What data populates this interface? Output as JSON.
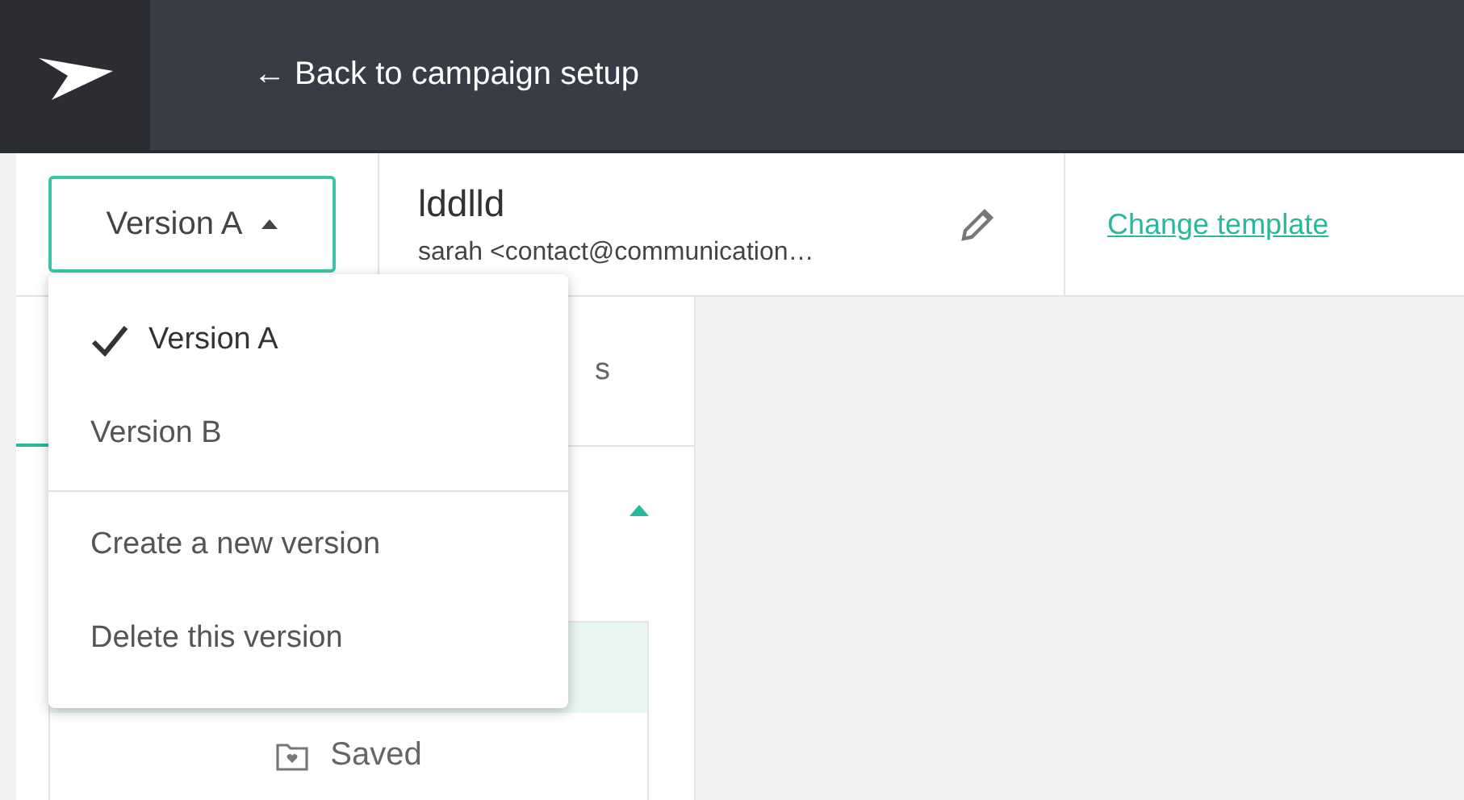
{
  "top_bar": {
    "back_link": "← Back to campaign setup"
  },
  "header": {
    "version_button": "Version A",
    "title": "lddlld",
    "sender": "sarah <contact@communication…",
    "change_template": "Change template"
  },
  "version_menu": {
    "versions": [
      {
        "label": "Version A",
        "selected": true
      },
      {
        "label": "Version B",
        "selected": false
      }
    ],
    "actions": [
      "Create a new version",
      "Delete this version"
    ]
  },
  "left_panel": {
    "tabs": [
      {
        "label": "s",
        "selected": false
      }
    ],
    "section_expanded": true,
    "saved_button": "Saved"
  }
}
